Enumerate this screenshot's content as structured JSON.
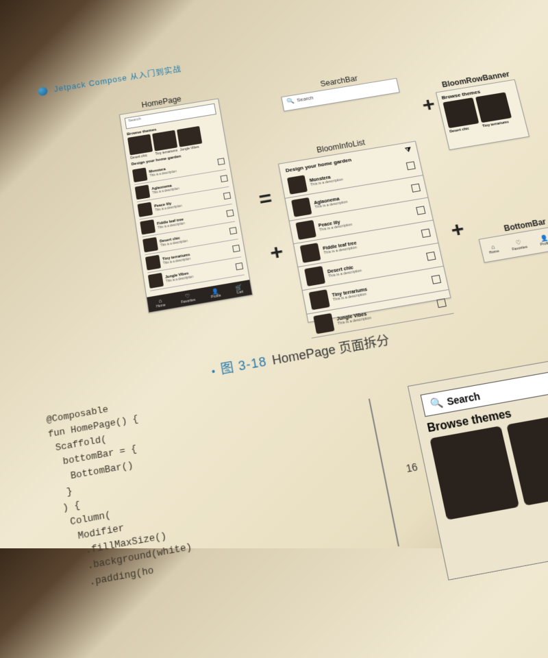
{
  "header": {
    "title": "Jetpack Compose 从入门到实战"
  },
  "labels": {
    "homepage": "HomePage",
    "searchbar": "SearchBar",
    "bloomlist": "BloomInfoList",
    "rowbanner": "BloomRowBanner",
    "bottombar": "BottomBar"
  },
  "ops": {
    "equals": "=",
    "plus": "+"
  },
  "searchbar": {
    "placeholder": "Search"
  },
  "homepage": {
    "search_placeholder": "Search",
    "browse_title": "Browse themes",
    "browse_items": [
      {
        "label": "Desert chic"
      },
      {
        "label": "Tiny terrariums"
      },
      {
        "label": "Jungle Vibes"
      }
    ],
    "design_title": "Design your home garden",
    "list": [
      {
        "title": "Monstera",
        "desc": "This is a description"
      },
      {
        "title": "Aglaonema",
        "desc": "This is a description"
      },
      {
        "title": "Peace lily",
        "desc": "This is a description"
      },
      {
        "title": "Fiddle leaf tree",
        "desc": "This is a description"
      },
      {
        "title": "Desert chic",
        "desc": "This is a description"
      },
      {
        "title": "Tiny terrariums",
        "desc": "This is a description"
      },
      {
        "title": "Jungle Vibes",
        "desc": "This is a description"
      }
    ],
    "nav": [
      {
        "icon": "⌂",
        "label": "Home"
      },
      {
        "icon": "♡",
        "label": "Favorites"
      },
      {
        "icon": "👤",
        "label": "Profile"
      },
      {
        "icon": "🛒",
        "label": "Cart"
      }
    ]
  },
  "bloomlist": {
    "title": "Design your home garden",
    "items": [
      {
        "title": "Monstera",
        "desc": "This is a description"
      },
      {
        "title": "Aglaonema",
        "desc": "This is a description"
      },
      {
        "title": "Peace lily",
        "desc": "This is a description"
      },
      {
        "title": "Fiddle leaf tree",
        "desc": "This is a description"
      },
      {
        "title": "Desert chic",
        "desc": "This is a description"
      },
      {
        "title": "Tiny terrariums",
        "desc": "This is a description"
      },
      {
        "title": "Jungle Vibes",
        "desc": "This is a description"
      }
    ]
  },
  "rowbanner": {
    "title": "Browse themes",
    "items": [
      {
        "label": "Desert chic"
      },
      {
        "label": "Tiny terrariums"
      }
    ]
  },
  "bottombar": {
    "items": [
      {
        "icon": "⌂",
        "label": "Home"
      },
      {
        "icon": "♡",
        "label": "Favorites"
      },
      {
        "icon": "👤",
        "label": "Profile"
      }
    ]
  },
  "figure": {
    "number": "图 3-18",
    "caption": "HomePage 页面拆分"
  },
  "code": "@Composable\nfun HomePage() {\n Scaffold(\n  bottomBar = {\n   BottomBar()\n  }\n ) {\n  Column(\n   Modifier\n    .fillMaxSize()\n    .background(white)\n    .padding(ho",
  "preview": {
    "search": "Search",
    "browse": "Browse themes",
    "measure": "16"
  }
}
